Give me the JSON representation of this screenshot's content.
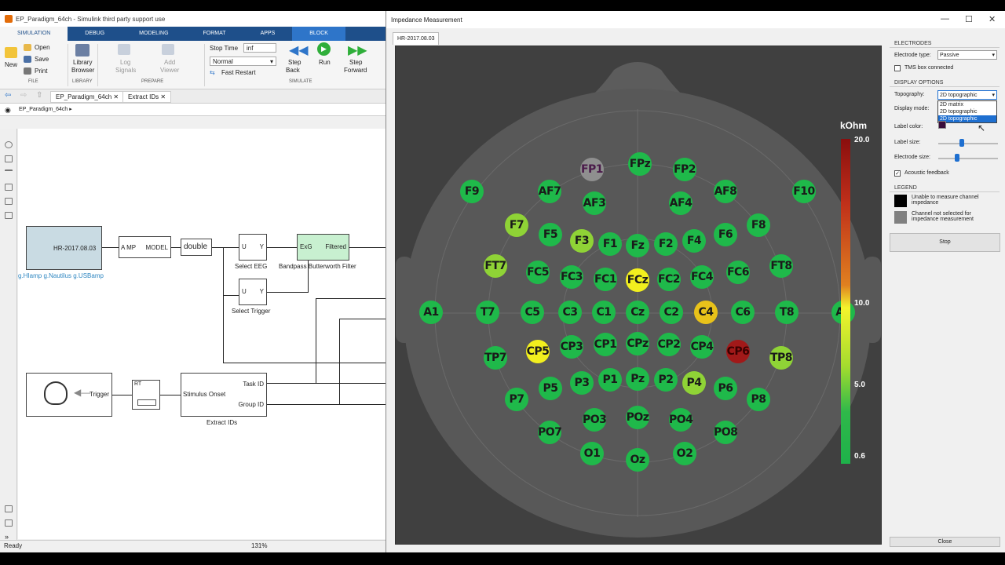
{
  "simulink": {
    "title": "EP_Paradigm_64ch - Simulink third party support use",
    "tabs": [
      "SIMULATION",
      "DEBUG",
      "MODELING",
      "FORMAT",
      "APPS",
      "BLOCK"
    ],
    "ribbon": {
      "new": "New",
      "open": "Open",
      "save": "Save",
      "print": "Print",
      "library_browser_1": "Library",
      "library_browser_2": "Browser",
      "log_signals_1": "Log",
      "log_signals_2": "Signals",
      "add_viewer_1": "Add",
      "add_viewer_2": "Viewer",
      "stop_time_label": "Stop Time",
      "stop_time_value": "inf",
      "mode_value": "Normal",
      "fast_restart": "Fast Restart",
      "step_back_1": "Step",
      "step_back_2": "Back",
      "run": "Run",
      "step_forward_1": "Step",
      "step_forward_2": "Forward",
      "groups": {
        "file": "FILE",
        "library": "LIBRARY",
        "prepare": "PREPARE",
        "simulate": "SIMULATE"
      }
    },
    "nav_tabs": [
      "EP_Paradigm_64ch",
      "Extract IDs"
    ],
    "path": "EP_Paradigm_64ch",
    "blocks": {
      "source": "HR-2017.08.03",
      "source_caption": "g.HIamp g.Nautilus g.USBamp",
      "amp_left": "A MP",
      "amp_right": "MODEL",
      "double": "double",
      "select_eeg": "Select EEG",
      "select_trigger": "Select Trigger",
      "u": "U",
      "y": "Y",
      "exg": "ExG",
      "filtered": "Filtered",
      "bandpass": "Bandpass Butterworth Filter",
      "trigger": "Trigger",
      "rt": "RT",
      "stim_onset": "Stimulus Onset",
      "task_id": "Task ID",
      "group_id": "Group ID",
      "extract_ids": "Extract IDs"
    },
    "status": "Ready",
    "zoom": "131%"
  },
  "impedance": {
    "title": "Impedance Measurement",
    "tab": "HR-2017.08.03",
    "colorbar": {
      "unit": "kOhm",
      "ticks": [
        "20.0",
        "10.0",
        "5.0",
        "0.6"
      ]
    },
    "electrodes": [
      {
        "n": "FPz",
        "c": "g"
      },
      {
        "n": "FP1",
        "c": "gr"
      },
      {
        "n": "FP2",
        "c": "g"
      },
      {
        "n": "F9",
        "c": "g"
      },
      {
        "n": "AF7",
        "c": "g"
      },
      {
        "n": "AF8",
        "c": "g"
      },
      {
        "n": "F10",
        "c": "g"
      },
      {
        "n": "AF3",
        "c": "g"
      },
      {
        "n": "AF4",
        "c": "g"
      },
      {
        "n": "F7",
        "c": "lg"
      },
      {
        "n": "F8",
        "c": "g"
      },
      {
        "n": "F5",
        "c": "g"
      },
      {
        "n": "F3",
        "c": "lg"
      },
      {
        "n": "F1",
        "c": "g"
      },
      {
        "n": "Fz",
        "c": "g"
      },
      {
        "n": "F2",
        "c": "g"
      },
      {
        "n": "F4",
        "c": "g"
      },
      {
        "n": "F6",
        "c": "g"
      },
      {
        "n": "FT7",
        "c": "lg"
      },
      {
        "n": "FT8",
        "c": "g"
      },
      {
        "n": "FC5",
        "c": "g"
      },
      {
        "n": "FC3",
        "c": "g"
      },
      {
        "n": "FC1",
        "c": "g"
      },
      {
        "n": "FCz",
        "c": "y"
      },
      {
        "n": "FC2",
        "c": "g"
      },
      {
        "n": "FC4",
        "c": "g"
      },
      {
        "n": "FC6",
        "c": "g"
      },
      {
        "n": "A1",
        "c": "g"
      },
      {
        "n": "T7",
        "c": "g"
      },
      {
        "n": "C5",
        "c": "g"
      },
      {
        "n": "C3",
        "c": "g"
      },
      {
        "n": "C1",
        "c": "g"
      },
      {
        "n": "Cz",
        "c": "g"
      },
      {
        "n": "C2",
        "c": "g"
      },
      {
        "n": "C4",
        "c": "o"
      },
      {
        "n": "C6",
        "c": "g"
      },
      {
        "n": "T8",
        "c": "g"
      },
      {
        "n": "A2",
        "c": "g"
      },
      {
        "n": "TP7",
        "c": "g"
      },
      {
        "n": "CP5",
        "c": "y"
      },
      {
        "n": "CP3",
        "c": "g"
      },
      {
        "n": "CP1",
        "c": "g"
      },
      {
        "n": "CPz",
        "c": "g"
      },
      {
        "n": "CP2",
        "c": "g"
      },
      {
        "n": "CP4",
        "c": "g"
      },
      {
        "n": "CP6",
        "c": "r"
      },
      {
        "n": "TP8",
        "c": "lg"
      },
      {
        "n": "P7",
        "c": "g"
      },
      {
        "n": "P5",
        "c": "g"
      },
      {
        "n": "P3",
        "c": "g"
      },
      {
        "n": "P1",
        "c": "g"
      },
      {
        "n": "Pz",
        "c": "g"
      },
      {
        "n": "P2",
        "c": "g"
      },
      {
        "n": "P4",
        "c": "lg"
      },
      {
        "n": "P6",
        "c": "g"
      },
      {
        "n": "P8",
        "c": "g"
      },
      {
        "n": "PO7",
        "c": "g"
      },
      {
        "n": "PO3",
        "c": "g"
      },
      {
        "n": "POz",
        "c": "g"
      },
      {
        "n": "PO4",
        "c": "g"
      },
      {
        "n": "PO8",
        "c": "g"
      },
      {
        "n": "O1",
        "c": "g"
      },
      {
        "n": "Oz",
        "c": "g"
      },
      {
        "n": "O2",
        "c": "g"
      }
    ],
    "panel": {
      "electrodes_header": "ELECTRODES",
      "electrode_type_label": "Electrode type:",
      "electrode_type_value": "Passive",
      "tms_label": "TMS box connected",
      "display_header": "DISPLAY OPTIONS",
      "topography_label": "Topography:",
      "topography_value": "2D topographic",
      "topography_options": [
        "2D matrix",
        "2D topographic",
        "2D topographic"
      ],
      "display_mode_label": "Display mode:",
      "label_color_label": "Label color:",
      "label_size_label": "Label size:",
      "electrode_size_label": "Electrode size:",
      "acoustic_label": "Acoustic feedback",
      "legend_header": "LEGEND",
      "legend_unable": "Unable to measure channel impedance",
      "legend_not_selected": "Channel not selected for impedance measurement",
      "stop_button": "Stop",
      "close_button": "Close"
    }
  }
}
